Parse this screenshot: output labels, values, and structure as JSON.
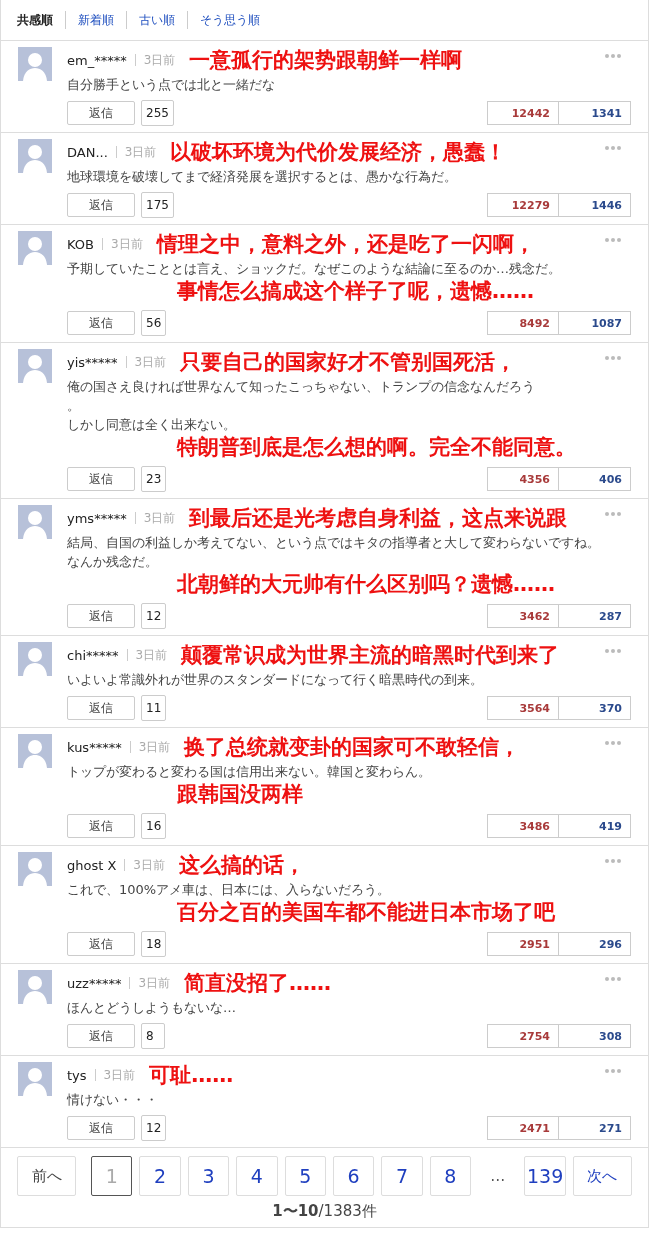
{
  "sort_tabs": [
    {
      "label": "共感順",
      "selected": true
    },
    {
      "label": "新着順",
      "selected": false
    },
    {
      "label": "古い順",
      "selected": false
    },
    {
      "label": "そう思う順",
      "selected": false
    }
  ],
  "comments": [
    {
      "user": "em_*****",
      "time": "3日前",
      "body": [
        "自分勝手という点では北と一緒だな"
      ],
      "reply": "返信",
      "reply_count": "255",
      "agree": "12442",
      "disagree": "1341",
      "annotation": [
        "一意孤行的架势跟朝鲜一样啊"
      ]
    },
    {
      "user": "DAN...",
      "time": "3日前",
      "body": [
        "地球環境を破壊してまで経済発展を選択するとは、愚かな行為だ。"
      ],
      "reply": "返信",
      "reply_count": "175",
      "agree": "12279",
      "disagree": "1446",
      "annotation": [
        "以破坏环境为代价发展经济，愚蠢！"
      ]
    },
    {
      "user": "KOB",
      "time": "3日前",
      "body": [
        "予期していたこととは言え、ショックだ。なぜこのような結論に至るのか…残念だ。"
      ],
      "reply": "返信",
      "reply_count": "56",
      "agree": "8492",
      "disagree": "1087",
      "annotation": [
        "情理之中，意料之外，还是吃了一闪啊，",
        "事情怎么搞成这个样子了呢，遗憾……"
      ]
    },
    {
      "user": "yis*****",
      "time": "3日前",
      "body": [
        "俺の国さえ良ければ世界なんて知ったこっちゃない、トランプの信念なんだろう",
        "。",
        "しかし同意は全く出来ない。"
      ],
      "reply": "返信",
      "reply_count": "23",
      "agree": "4356",
      "disagree": "406",
      "annotation": [
        "只要自己的国家好才不管别国死活，",
        "特朗普到底是怎么想的啊。完全不能同意。"
      ]
    },
    {
      "user": "yms*****",
      "time": "3日前",
      "body": [
        "結局、自国の利益しか考えてない、という点ではキタの指導者と大して変わらないですね。",
        "なんか残念だ。"
      ],
      "reply": "返信",
      "reply_count": "12",
      "agree": "3462",
      "disagree": "287",
      "annotation": [
        "到最后还是光考虑自身利益，这点来说跟",
        "北朝鲜的大元帅有什么区别吗？遗憾……"
      ]
    },
    {
      "user": "chi*****",
      "time": "3日前",
      "body": [
        "いよいよ常識外れが世界のスタンダードになって行く暗黒時代の到来。"
      ],
      "reply": "返信",
      "reply_count": "11",
      "agree": "3564",
      "disagree": "370",
      "annotation": [
        "颠覆常识成为世界主流的暗黑时代到来了"
      ]
    },
    {
      "user": "kus*****",
      "time": "3日前",
      "body": [
        "トップが変わると変わる国は信用出来ない。韓国と変わらん。"
      ],
      "reply": "返信",
      "reply_count": "16",
      "agree": "3486",
      "disagree": "419",
      "annotation": [
        "换了总统就变卦的国家可不敢轻信，",
        "跟韩国没两样"
      ]
    },
    {
      "user": "ghost X",
      "time": "3日前",
      "body": [
        "これで、100%アメ車は、日本には、入らないだろう。"
      ],
      "reply": "返信",
      "reply_count": "18",
      "agree": "2951",
      "disagree": "296",
      "annotation": [
        "这么搞的话，",
        "百分之百的美国车都不能进日本市场了吧"
      ]
    },
    {
      "user": "uzz*****",
      "time": "3日前",
      "body": [
        "ほんとどうしようもないな…"
      ],
      "reply": "返信",
      "reply_count": "8",
      "agree": "2754",
      "disagree": "308",
      "annotation": [
        "简直没招了……"
      ]
    },
    {
      "user": "tys",
      "time": "3日前",
      "body": [
        "情けない・・・"
      ],
      "reply": "返信",
      "reply_count": "12",
      "agree": "2471",
      "disagree": "271",
      "annotation": [
        "可耻……"
      ]
    }
  ],
  "pagination": {
    "prev": "前へ",
    "pages": [
      {
        "label": "1",
        "selected": true
      },
      {
        "label": "2",
        "selected": false
      },
      {
        "label": "3",
        "selected": false
      },
      {
        "label": "4",
        "selected": false
      },
      {
        "label": "5",
        "selected": false
      },
      {
        "label": "6",
        "selected": false
      },
      {
        "label": "7",
        "selected": false
      },
      {
        "label": "8",
        "selected": false
      }
    ],
    "ellipsis": "…",
    "last": "139",
    "next": "次へ",
    "summary": "**1〜10**/1383件"
  }
}
